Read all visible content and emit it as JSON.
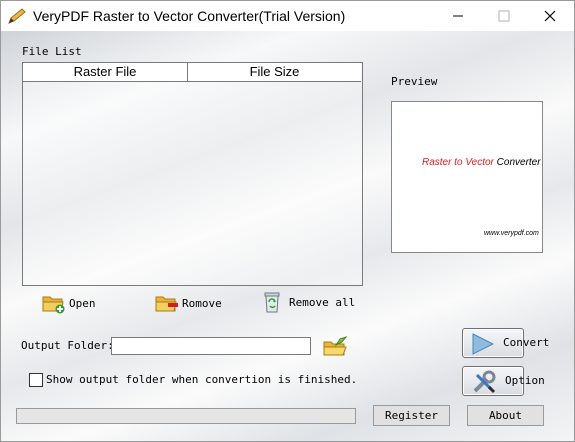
{
  "window": {
    "title": "VeryPDF Raster to Vector Converter(Trial Version)"
  },
  "file_list": {
    "label": "File List",
    "columns": [
      "Raster File",
      "File Size"
    ]
  },
  "preview": {
    "label": "Preview",
    "text_colored": "Raster to Vector",
    "text_plain": "Converter",
    "url": "www.verypdf.com"
  },
  "actions": {
    "open": "Open",
    "remove": "Romove",
    "remove_all": "Remove all"
  },
  "output": {
    "label": "Output Folder:",
    "value": "",
    "show_folder_label": "Show output folder when convertion is finished.",
    "show_folder_checked": false
  },
  "buttons": {
    "convert": "Convert",
    "option": "Option",
    "register": "Register",
    "about": "About"
  },
  "progress": {
    "value": 0
  },
  "colors": {
    "preview_red": "#d81e1e",
    "progress_blue": "#4fa3e3"
  }
}
